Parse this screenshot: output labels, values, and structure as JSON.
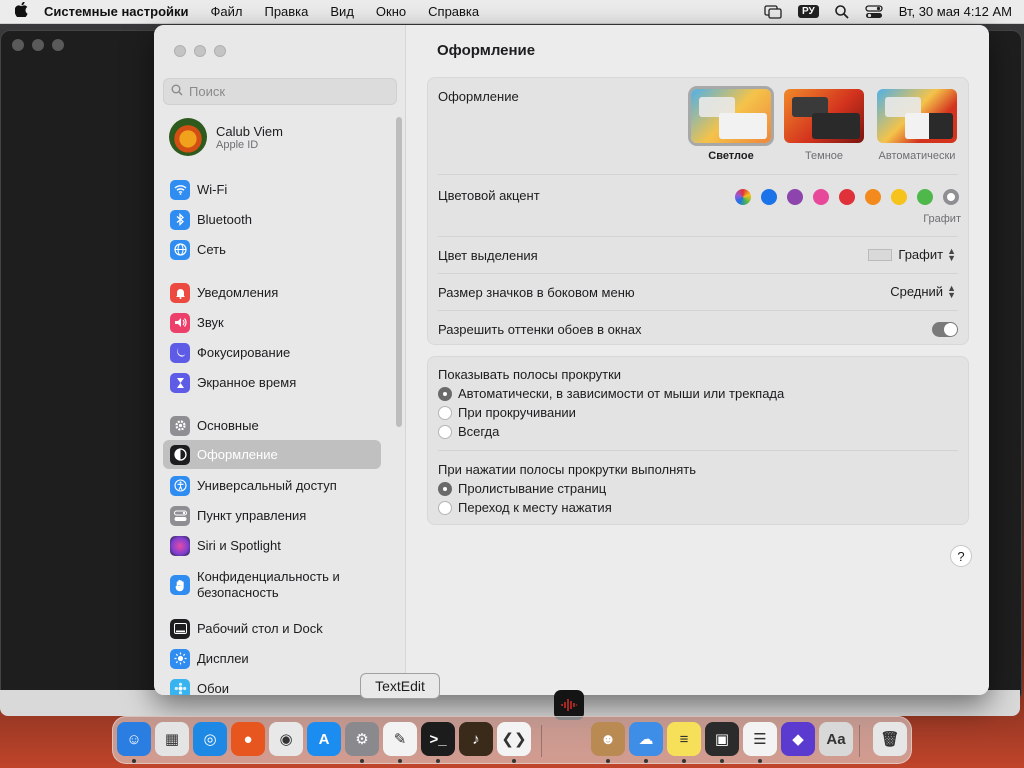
{
  "menubar": {
    "app_name": "Системные настройки",
    "items": [
      "Файл",
      "Правка",
      "Вид",
      "Окно",
      "Справка"
    ],
    "input_source": "РУ",
    "datetime": "Вт, 30 мая  4:12 AM"
  },
  "sidebar": {
    "search_placeholder": "Поиск",
    "user": {
      "name": "Calub Viem",
      "subtitle": "Apple ID"
    },
    "items": [
      {
        "label": "Wi-Fi",
        "icon": "wifi-icon",
        "color": "#2f8cf0"
      },
      {
        "label": "Bluetooth",
        "icon": "bluetooth-icon",
        "color": "#2f8cf0"
      },
      {
        "label": "Сеть",
        "icon": "globe-icon",
        "color": "#2f8cf0"
      },
      {
        "label": "Уведомления",
        "icon": "bell-icon",
        "color": "#ec4a41"
      },
      {
        "label": "Звук",
        "icon": "speaker-icon",
        "color": "#ec3f6a"
      },
      {
        "label": "Фокусирование",
        "icon": "moon-icon",
        "color": "#5e5ce6"
      },
      {
        "label": "Экранное время",
        "icon": "hourglass-icon",
        "color": "#5e5ce6"
      },
      {
        "label": "Основные",
        "icon": "gear-icon",
        "color": "#8e8e93"
      },
      {
        "label": "Оформление",
        "icon": "appearance-icon",
        "color": "#1d1d1f"
      },
      {
        "label": "Универсальный доступ",
        "icon": "accessibility-icon",
        "color": "#2f8cf0"
      },
      {
        "label": "Пункт управления",
        "icon": "control-center-icon",
        "color": "#8e8e93"
      },
      {
        "label": "Siri и Spotlight",
        "icon": "siri-icon",
        "color": "#7b3fd1"
      },
      {
        "label": "Конфиденциальность и безопасность",
        "icon": "hand-icon",
        "color": "#2f8cf0"
      },
      {
        "label": "Рабочий стол и Dock",
        "icon": "dock-icon",
        "color": "#1d1d1f"
      },
      {
        "label": "Дисплеи",
        "icon": "sun-icon",
        "color": "#2f8cf0"
      },
      {
        "label": "Обои",
        "icon": "wallpaper-icon",
        "color": "#37b4f0"
      }
    ],
    "selected": "Оформление"
  },
  "content": {
    "title": "Оформление",
    "appearance_label": "Оформление",
    "appearance_options": [
      "Светлое",
      "Темное",
      "Автоматически"
    ],
    "appearance_selected": "Светлое",
    "accent_label": "Цветовой акцент",
    "accent_colors": [
      "#9b59d6",
      "#1a73e8",
      "#8e44ad",
      "#e8489a",
      "#e0313a",
      "#f28a1e",
      "#f6c21c",
      "#4fb84a",
      "#8e8e93"
    ],
    "accent_selected_name": "Графит",
    "highlight_label": "Цвет выделения",
    "highlight_value": "Графит",
    "sidebar_icon_label": "Размер значков в боковом меню",
    "sidebar_icon_value": "Средний",
    "tinting_label": "Разрешить оттенки обоев в окнах",
    "tinting_on": true,
    "scrollbars_label": "Показывать полосы прокрутки",
    "scrollbars_options": [
      "Автоматически, в зависимости от мыши или трекпада",
      "При прокручивании",
      "Всегда"
    ],
    "scrollbars_selected": 0,
    "click_label": "При нажатии полосы прокрутки выполнять",
    "click_options": [
      "Пролистывание страниц",
      "Переход к месту нажатия"
    ],
    "click_selected": 0,
    "help": "?"
  },
  "dock": {
    "tooltip": "TextEdit",
    "apps": [
      {
        "name": "finder-icon",
        "color": "#2a7de1",
        "glyph": "☺",
        "running": true
      },
      {
        "name": "launchpad-icon",
        "color": "#e4e4e4",
        "glyph": "▦",
        "running": false
      },
      {
        "name": "safari-icon",
        "color": "#1e88e5",
        "glyph": "◎",
        "running": false
      },
      {
        "name": "firefox-icon",
        "color": "#e8561f",
        "glyph": "●",
        "running": false
      },
      {
        "name": "chrome-icon",
        "color": "#e8e8e8",
        "glyph": "◉",
        "running": false
      },
      {
        "name": "app-store-icon",
        "color": "#1c8df0",
        "glyph": "A",
        "running": false
      },
      {
        "name": "system-settings-icon",
        "color": "#8a8a8e",
        "glyph": "⚙",
        "running": true
      },
      {
        "name": "textedit-icon",
        "color": "#f3f3f3",
        "glyph": "✎",
        "running": true
      },
      {
        "name": "terminal-icon",
        "color": "#1c1c1c",
        "glyph": ">_",
        "running": true
      },
      {
        "name": "instruments-icon",
        "color": "#3a2a1a",
        "glyph": "♪",
        "running": false
      },
      {
        "name": "vscode-icon",
        "color": "#f3f3f3",
        "glyph": "❮❯",
        "running": true
      },
      {
        "name": "contacts-icon",
        "color": "#b98a52",
        "glyph": "☻",
        "running": true
      },
      {
        "name": "weather-icon",
        "color": "#3e8ee8",
        "glyph": "☁",
        "running": true
      },
      {
        "name": "notes-icon",
        "color": "#f6e05a",
        "glyph": "≡",
        "running": true
      },
      {
        "name": "photo-booth-icon",
        "color": "#2b2b2b",
        "glyph": "▣",
        "running": true
      },
      {
        "name": "reminders-icon",
        "color": "#f3f3f3",
        "glyph": "☰",
        "running": true
      },
      {
        "name": "shortcuts-icon",
        "color": "#5b3ad0",
        "glyph": "◆",
        "running": false
      },
      {
        "name": "font-book-icon",
        "color": "#d8d8d8",
        "glyph": "Aa",
        "running": false
      },
      {
        "name": "trash-icon",
        "color": "#e6e6e6",
        "glyph": "🗑",
        "running": false
      }
    ]
  }
}
